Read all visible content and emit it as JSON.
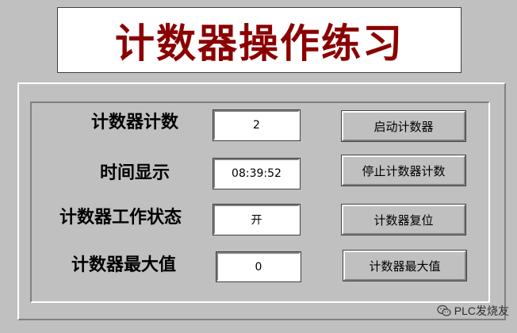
{
  "title": "计数器操作练习",
  "rows": [
    {
      "label": "计数器计数",
      "value": "2",
      "button": "启动计数器"
    },
    {
      "label": "时间显示",
      "value": "08:39:52",
      "button": "停止计数器计数"
    },
    {
      "label": "计数器工作状态",
      "value": "开",
      "button": "计数器复位"
    },
    {
      "label": "计数器最大值",
      "value": "0",
      "button": "计数器最大值"
    }
  ],
  "watermark": "PLC发烧友",
  "colors": {
    "background": "#c0c0c0",
    "title": "#8b0000",
    "field": "#ffffff"
  }
}
